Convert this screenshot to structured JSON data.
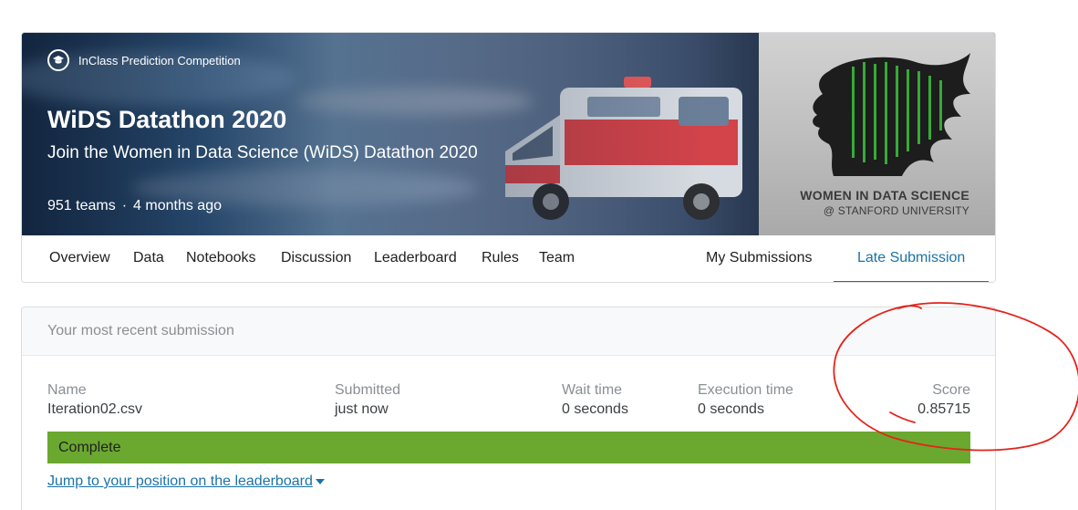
{
  "competition": {
    "type_label": "InClass Prediction Competition",
    "title": "WiDS Datathon 2020",
    "subtitle": "Join the Women in Data Science (WiDS) Datathon 2020",
    "teams": "951 teams",
    "separator": "·",
    "age": "4 months ago",
    "logo": {
      "line1": "WOMEN IN DATA SCIENCE",
      "line2": "@ STANFORD UNIVERSITY"
    }
  },
  "tabs": [
    {
      "label": "Overview"
    },
    {
      "label": "Data"
    },
    {
      "label": "Notebooks"
    },
    {
      "label": "Discussion"
    },
    {
      "label": "Leaderboard"
    },
    {
      "label": "Rules"
    },
    {
      "label": "Team"
    },
    {
      "label": "My Submissions"
    },
    {
      "label": "Late Submission",
      "active": true
    }
  ],
  "submission": {
    "header": "Your most recent submission",
    "columns": {
      "name": {
        "label": "Name",
        "value": "Iteration02.csv"
      },
      "submitted": {
        "label": "Submitted",
        "value": "just now"
      },
      "wait": {
        "label": "Wait time",
        "value": "0 seconds"
      },
      "execution": {
        "label": "Execution time",
        "value": "0 seconds"
      },
      "score": {
        "label": "Score",
        "value": "0.85715"
      }
    },
    "status": "Complete",
    "jump_link": "Jump to your position on the leaderboard"
  },
  "colors": {
    "accent": "#1a73a8",
    "status_complete": "#6ba82f",
    "annotation": "#e3241b"
  },
  "icons": {
    "competition_type": "graduation-cap-icon",
    "dropdown": "caret-down-icon"
  }
}
